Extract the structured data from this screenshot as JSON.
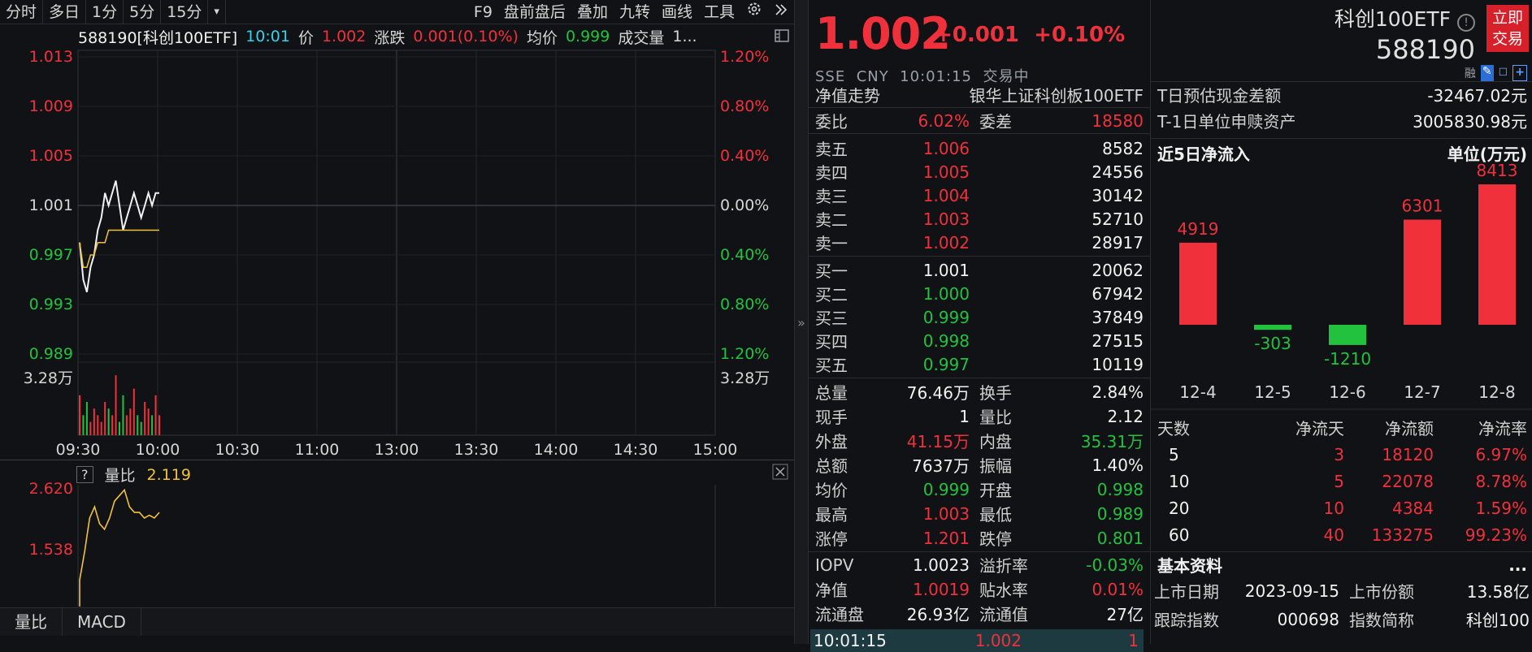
{
  "toolbar": {
    "left": [
      "分时",
      "多日",
      "1分",
      "5分",
      "15分",
      "▾"
    ],
    "right": [
      "F9",
      "盘前盘后",
      "叠加",
      "九转",
      "画线",
      "工具"
    ]
  },
  "info": {
    "symbol": "588190[科创100ETF]",
    "time": "10:01",
    "price_label": "价",
    "price": "1.002",
    "chg_label": "涨跌",
    "chg": "0.001(0.10%)",
    "avg_label": "均价",
    "avg": "0.999",
    "vol_label": "成交量",
    "vol": "1..."
  },
  "chart_data": {
    "type": "line",
    "y_left_ticks": [
      "1.013",
      "1.009",
      "1.005",
      "1.001",
      "0.997",
      "0.993",
      "0.989"
    ],
    "y_right_ticks": [
      "1.20%",
      "0.80%",
      "0.40%",
      "0.00%",
      "0.40%",
      "0.80%",
      "1.20%"
    ],
    "x_ticks": [
      "09:30",
      "10:00",
      "10:30",
      "11:00",
      "13:00",
      "13:30",
      "14:00",
      "14:30",
      "15:00"
    ],
    "vol_tick": "3.28万",
    "price_series": [
      0.998,
      0.995,
      0.994,
      0.996,
      0.997,
      0.999,
      1.0,
      1.002,
      1.001,
      1.002,
      1.003,
      1.001,
      0.999,
      1.0,
      1.001,
      1.002,
      1.001,
      1.0,
      1.001,
      1.002,
      1.001,
      1.002,
      1.002
    ],
    "avg_series": [
      0.998,
      0.996,
      0.996,
      0.997,
      0.997,
      0.998,
      0.998,
      0.998,
      0.999,
      0.999,
      0.999,
      0.999,
      0.999,
      0.999,
      0.999,
      0.999,
      0.999,
      0.999,
      0.999,
      0.999,
      0.999,
      0.999,
      0.999
    ],
    "volume_series": [
      0.6,
      0.3,
      0.5,
      0.2,
      0.4,
      0.3,
      0.2,
      0.5,
      0.4,
      0.3,
      0.9,
      0.2,
      0.6,
      0.3,
      0.4,
      0.7,
      0.3,
      0.2,
      0.5,
      0.4,
      0.3,
      0.6,
      0.3
    ]
  },
  "lower": {
    "q": "?",
    "label": "量比",
    "value": "2.119",
    "ticks": [
      "2.620",
      "1.538"
    ],
    "series": [
      1.0,
      1.5,
      2.1,
      2.3,
      2.0,
      1.9,
      2.1,
      2.4,
      2.5,
      2.6,
      2.3,
      2.2,
      2.2,
      2.1,
      2.15,
      2.1,
      2.2
    ]
  },
  "bottom_tabs": [
    "量比",
    "MACD"
  ],
  "quote": {
    "price": "1.002",
    "change": "+0.001",
    "pct": "+0.10%",
    "exchange": "SSE",
    "currency": "CNY",
    "time": "10:01:15",
    "status": "交易中",
    "name": "科创100ETF",
    "code": "588190",
    "trade_btn": "立即交易",
    "icons": [
      "融",
      "✎",
      "◻",
      "+"
    ]
  },
  "nav": {
    "label": "净值走势",
    "value": "银华上证科创板100ETF"
  },
  "weibi": {
    "l1": "委比",
    "v1": "6.02%",
    "l2": "委差",
    "v2": "18580"
  },
  "asks": [
    {
      "l": "卖五",
      "p": "1.006",
      "v": "8582"
    },
    {
      "l": "卖四",
      "p": "1.005",
      "v": "24556"
    },
    {
      "l": "卖三",
      "p": "1.004",
      "v": "30142"
    },
    {
      "l": "卖二",
      "p": "1.003",
      "v": "52710"
    },
    {
      "l": "卖一",
      "p": "1.002",
      "v": "28917"
    }
  ],
  "bids": [
    {
      "l": "买一",
      "p": "1.001",
      "v": "20062"
    },
    {
      "l": "买二",
      "p": "1.000",
      "v": "67942"
    },
    {
      "l": "买三",
      "p": "0.999",
      "v": "37849"
    },
    {
      "l": "买四",
      "p": "0.998",
      "v": "27515"
    },
    {
      "l": "买五",
      "p": "0.997",
      "v": "10119"
    }
  ],
  "stats": [
    {
      "l1": "总量",
      "v1": "76.46万",
      "c1": "white",
      "l2": "换手",
      "v2": "2.84%",
      "c2": "white"
    },
    {
      "l1": "现手",
      "v1": "1",
      "c1": "white",
      "l2": "量比",
      "v2": "2.12",
      "c2": "white"
    },
    {
      "l1": "外盘",
      "v1": "41.15万",
      "c1": "red",
      "l2": "内盘",
      "v2": "35.31万",
      "c2": "green"
    },
    {
      "l1": "总额",
      "v1": "7637万",
      "c1": "white",
      "l2": "振幅",
      "v2": "1.40%",
      "c2": "white"
    },
    {
      "l1": "均价",
      "v1": "0.999",
      "c1": "green",
      "l2": "开盘",
      "v2": "0.998",
      "c2": "green"
    },
    {
      "l1": "最高",
      "v1": "1.003",
      "c1": "red",
      "l2": "最低",
      "v2": "0.989",
      "c2": "green"
    },
    {
      "l1": "涨停",
      "v1": "1.201",
      "c1": "red",
      "l2": "跌停",
      "v2": "0.801",
      "c2": "green"
    }
  ],
  "iopv": [
    {
      "l1": "IOPV",
      "v1": "1.0023",
      "c1": "white",
      "l2": "溢折率",
      "v2": "-0.03%",
      "c2": "green"
    },
    {
      "l1": "净值",
      "v1": "1.0019",
      "c1": "red",
      "l2": "贴水率",
      "v2": "0.01%",
      "c2": "red"
    },
    {
      "l1": "流通盘",
      "v1": "26.93亿",
      "c1": "white",
      "l2": "流通值",
      "v2": "27亿",
      "c2": "white"
    }
  ],
  "tick": {
    "time": "10:01:15",
    "price": "1.002",
    "vol": "1"
  },
  "etf": [
    {
      "l": "T日预估现金差额",
      "v": "-32467.02元"
    },
    {
      "l": "T-1日单位申赎资产",
      "v": "3005830.98元"
    }
  ],
  "flow": {
    "title": "近5日净流入",
    "unit": "单位(万元)",
    "colors": {
      "pos": "#f0313c",
      "neg": "#23c23e"
    }
  },
  "flow_chart": {
    "type": "bar",
    "categories": [
      "12-4",
      "12-5",
      "12-6",
      "12-7",
      "12-8"
    ],
    "values": [
      4919,
      -303,
      -1210,
      6301,
      8413
    ]
  },
  "flow_table": {
    "headers": [
      "天数",
      "净流天",
      "净流额",
      "净流率"
    ],
    "rows": [
      [
        "5",
        "3",
        "18120",
        "6.97%"
      ],
      [
        "10",
        "5",
        "22078",
        "8.78%"
      ],
      [
        "20",
        "10",
        "4384",
        "1.59%"
      ],
      [
        "60",
        "40",
        "133275",
        "99.23%"
      ]
    ]
  },
  "basic": {
    "title": "基本资料",
    "more": "...",
    "rows": [
      {
        "l1": "上市日期",
        "v1": "2023-09-15",
        "l2": "上市份额",
        "v2": "13.58亿"
      },
      {
        "l1": "跟踪指数",
        "v1": "000698",
        "l2": "指数简称",
        "v2": "科创100"
      }
    ]
  }
}
